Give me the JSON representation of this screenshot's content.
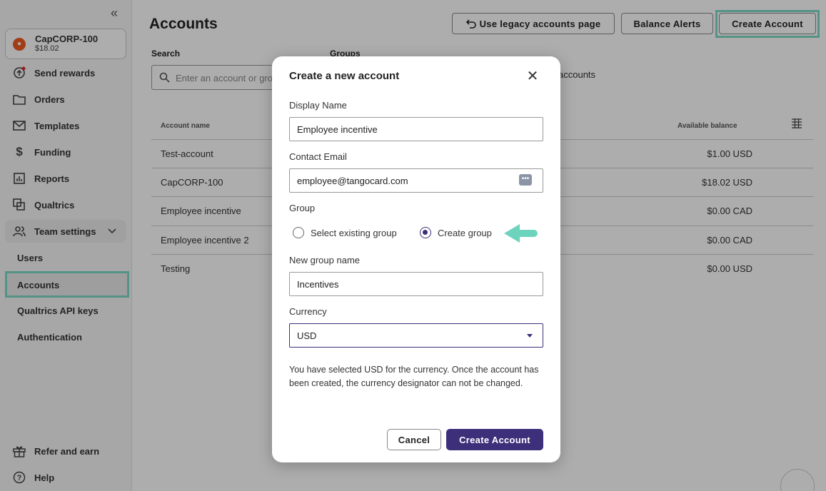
{
  "sidebar": {
    "collapse_glyph": "«",
    "account": {
      "name": "CapCORP-100",
      "balance": "$18.02"
    },
    "nav": [
      {
        "label": "Send rewards",
        "icon": "send-rewards-icon"
      },
      {
        "label": "Orders",
        "icon": "folder-icon"
      },
      {
        "label": "Templates",
        "icon": "envelope-icon"
      },
      {
        "label": "Funding",
        "icon": "dollar-icon"
      },
      {
        "label": "Reports",
        "icon": "bar-chart-icon"
      },
      {
        "label": "Qualtrics",
        "icon": "qualtrics-icon"
      }
    ],
    "team_settings": {
      "label": "Team settings",
      "icon": "users-icon"
    },
    "sub_items": [
      {
        "label": "Users"
      },
      {
        "label": "Accounts"
      },
      {
        "label": "Qualtrics API keys"
      },
      {
        "label": "Authentication"
      }
    ],
    "bottom": [
      {
        "label": "Refer and earn",
        "icon": "gift-icon"
      },
      {
        "label": "Help",
        "icon": "help-icon"
      }
    ]
  },
  "main": {
    "title": "Accounts",
    "buttons": {
      "legacy": "Use legacy accounts page",
      "alerts": "Balance Alerts",
      "create": "Create Account"
    },
    "search": {
      "label": "Search",
      "placeholder": "Enter an account or group"
    },
    "groups": {
      "label": "Groups",
      "value_fragment": "accounts"
    },
    "table": {
      "headers": {
        "name": "Account name",
        "balance": "Available balance"
      },
      "rows": [
        {
          "name": "Test-account",
          "balance": "$1.00 USD"
        },
        {
          "name": "CapCORP-100",
          "balance": "$18.02 USD"
        },
        {
          "name": "Employee incentive",
          "balance": "$0.00 CAD"
        },
        {
          "name": "Employee incentive 2",
          "balance": "$0.00 CAD"
        },
        {
          "name": "Testing",
          "balance": "$0.00 USD"
        }
      ]
    }
  },
  "modal": {
    "title": "Create a new account",
    "close_glyph": "✕",
    "display_name": {
      "label": "Display Name",
      "value": "Employee incentive"
    },
    "contact_email": {
      "label": "Contact Email",
      "value": "employee@tangocard.com"
    },
    "group": {
      "label": "Group",
      "options": [
        {
          "label": "Select existing group",
          "selected": false
        },
        {
          "label": "Create group",
          "selected": true
        }
      ]
    },
    "new_group_name": {
      "label": "New group name",
      "value": "Incentives"
    },
    "currency": {
      "label": "Currency",
      "value": "USD"
    },
    "note": "You have selected USD for the currency. Once the account has been created, the currency designator can not be changed.",
    "cancel_label": "Cancel",
    "submit_label": "Create Account"
  },
  "colors": {
    "primary": "#3d2f7a",
    "highlight": "#7dd9c6",
    "arrow": "#6ed3bd",
    "brand_orange": "#f05a22"
  }
}
